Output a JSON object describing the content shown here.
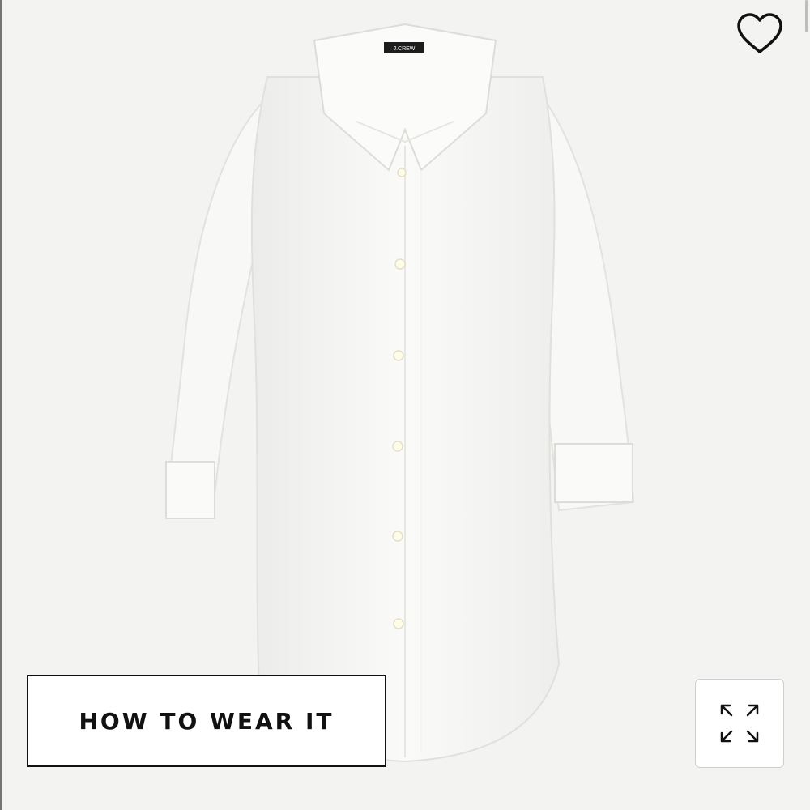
{
  "product": {
    "image_alt": "white shirt dress",
    "brand_tag": "J.CREW"
  },
  "actions": {
    "how_to_wear_label": "HOW TO WEAR IT",
    "favorite_icon": "heart-icon",
    "zoom_icon": "expand-icon"
  },
  "colors": {
    "background": "#f3f3f2",
    "button_border": "#111111",
    "text": "#111111"
  }
}
